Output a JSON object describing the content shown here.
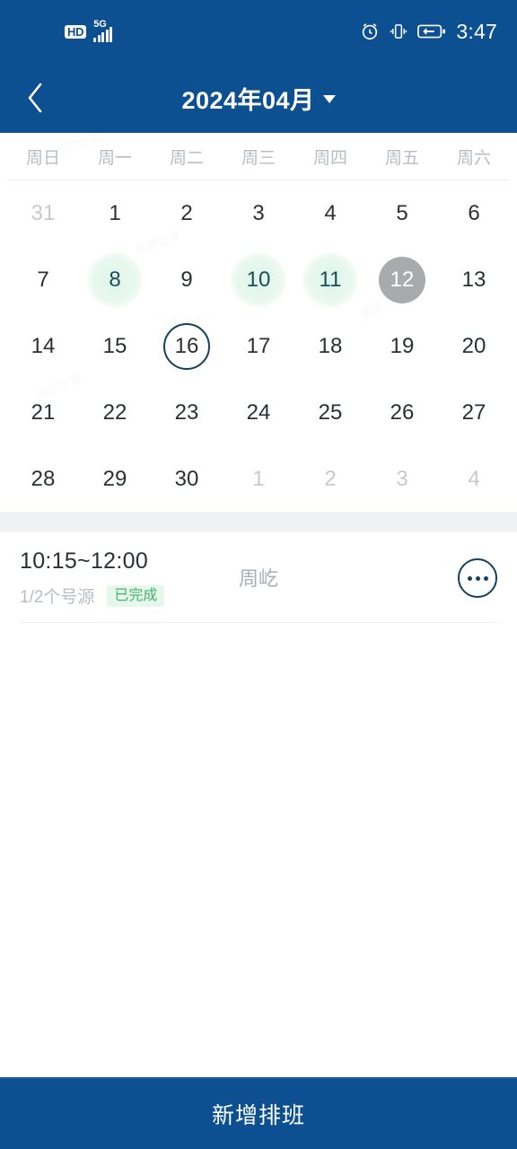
{
  "statusbar": {
    "hd_label": "HD",
    "network_label": "5G",
    "time": "3:47",
    "icons": [
      "hd-badge",
      "5g-signal-icon",
      "alarm-icon",
      "vibrate-icon",
      "battery-charging-icon"
    ]
  },
  "header": {
    "back_icon": "chevron-left-icon",
    "title": "2024年04月",
    "dropdown_icon": "caret-down-icon"
  },
  "calendar": {
    "weekdays": [
      "周日",
      "周一",
      "周二",
      "周三",
      "周四",
      "周五",
      "周六"
    ],
    "weeks": [
      [
        {
          "n": "31",
          "state": "outside"
        },
        {
          "n": "1",
          "state": "normal"
        },
        {
          "n": "2",
          "state": "normal"
        },
        {
          "n": "3",
          "state": "normal"
        },
        {
          "n": "4",
          "state": "normal"
        },
        {
          "n": "5",
          "state": "normal"
        },
        {
          "n": "6",
          "state": "normal"
        }
      ],
      [
        {
          "n": "7",
          "state": "normal"
        },
        {
          "n": "8",
          "state": "event"
        },
        {
          "n": "9",
          "state": "normal"
        },
        {
          "n": "10",
          "state": "event"
        },
        {
          "n": "11",
          "state": "event"
        },
        {
          "n": "12",
          "state": "today"
        },
        {
          "n": "13",
          "state": "normal"
        }
      ],
      [
        {
          "n": "14",
          "state": "normal"
        },
        {
          "n": "15",
          "state": "normal"
        },
        {
          "n": "16",
          "state": "selected"
        },
        {
          "n": "17",
          "state": "normal"
        },
        {
          "n": "18",
          "state": "normal"
        },
        {
          "n": "19",
          "state": "normal"
        },
        {
          "n": "20",
          "state": "normal"
        }
      ],
      [
        {
          "n": "21",
          "state": "normal"
        },
        {
          "n": "22",
          "state": "normal"
        },
        {
          "n": "23",
          "state": "normal"
        },
        {
          "n": "24",
          "state": "normal"
        },
        {
          "n": "25",
          "state": "normal"
        },
        {
          "n": "26",
          "state": "normal"
        },
        {
          "n": "27",
          "state": "normal"
        }
      ],
      [
        {
          "n": "28",
          "state": "normal"
        },
        {
          "n": "29",
          "state": "normal"
        },
        {
          "n": "30",
          "state": "normal"
        },
        {
          "n": "1",
          "state": "outside"
        },
        {
          "n": "2",
          "state": "outside"
        },
        {
          "n": "3",
          "state": "outside"
        },
        {
          "n": "4",
          "state": "outside"
        }
      ]
    ]
  },
  "appointments": [
    {
      "time": "10:15~12:00",
      "count": "1/2个号源",
      "status": "已完成",
      "name": "周屹",
      "more_icon": "more-options-icon"
    }
  ],
  "bottom": {
    "add_label": "新增排班"
  },
  "colors": {
    "brand_blue": "#0d5091",
    "event_green_bg": "#e4f5ea",
    "event_text": "#17505c",
    "today_gray": "#a9aaab",
    "selected_outline": "#13415f",
    "badge_text": "#45b36b",
    "badge_bg": "#e6f7ec"
  },
  "watermarks": [
    "医护之家",
    "医护之家",
    "医护之家",
    "医护之家",
    "医护之家",
    "医护之家",
    "医护之家",
    "医护之家"
  ]
}
